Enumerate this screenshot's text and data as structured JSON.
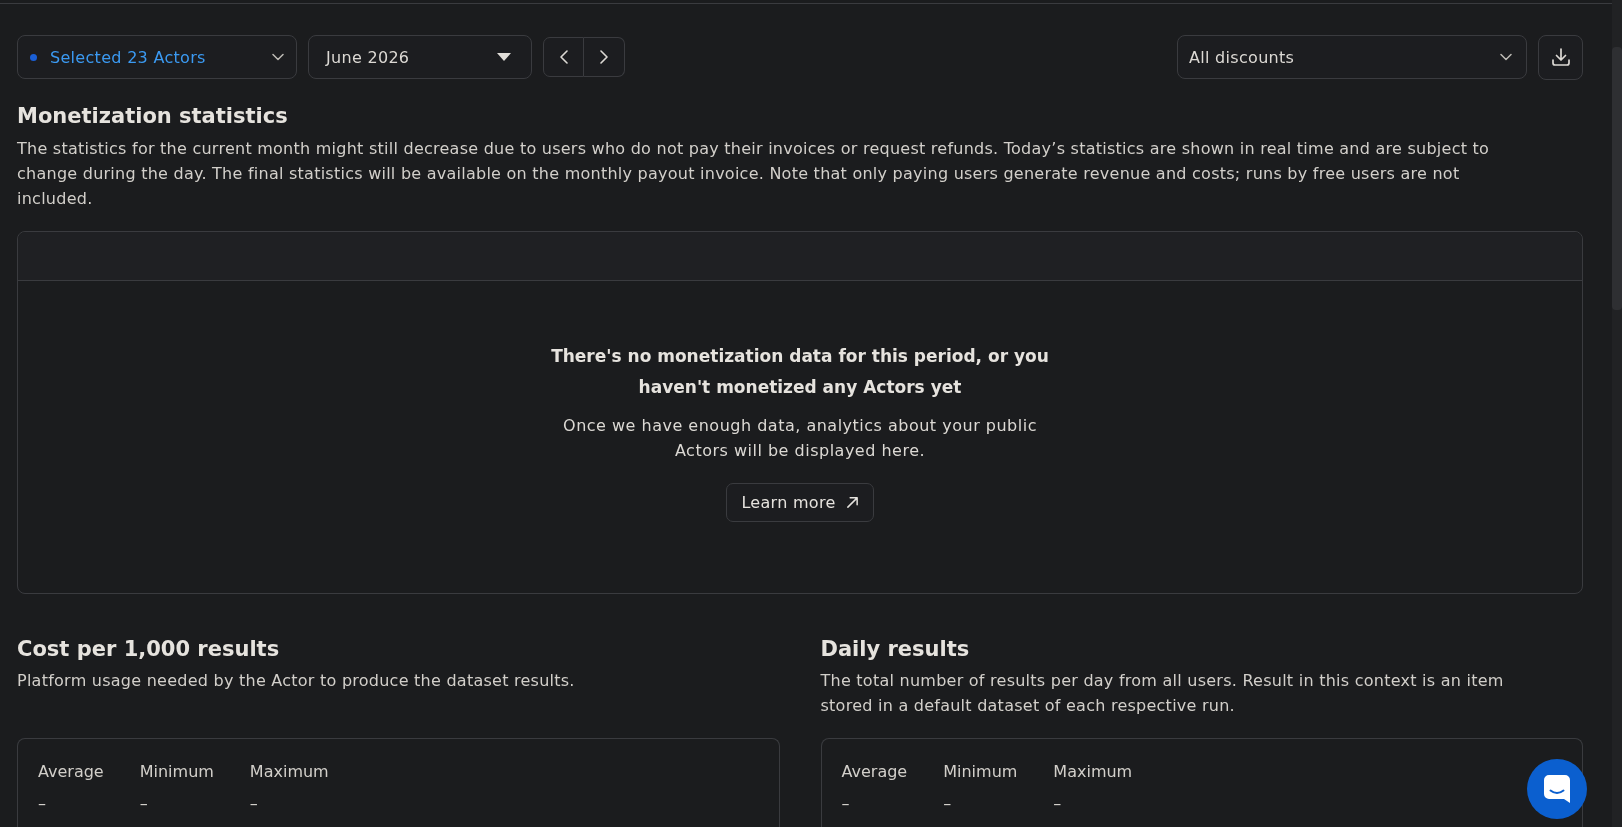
{
  "filters": {
    "actor_select": {
      "value": "Selected 23 Actors"
    },
    "month_select": {
      "value": "June 2026"
    },
    "discount_select": {
      "value": "All discounts"
    }
  },
  "monetization": {
    "title": "Monetization statistics",
    "description": "The statistics for the current month might still decrease due to users who do not pay their invoices or request refunds. Today’s statistics are shown in real time and are subject to change during the day. The final statistics will be available on the monthly payout invoice. Note that only paying users generate revenue and costs; runs by free users are not included.",
    "empty_state": {
      "title": "There's no monetization data for this period, or you haven't monetized any Actors yet",
      "message": "Once we have enough data, analytics about your public Actors will be displayed here.",
      "button": "Learn more"
    }
  },
  "sections": [
    {
      "title": "Cost per 1,000 results",
      "description": "Platform usage needed by the Actor to produce the dataset results.",
      "stats": [
        {
          "label": "Average",
          "value": "–"
        },
        {
          "label": "Minimum",
          "value": "–"
        },
        {
          "label": "Maximum",
          "value": "–"
        }
      ]
    },
    {
      "title": "Daily results",
      "description": "The total number of results per day from all users. Result in this context is an item stored in a default dataset of each respective run.",
      "stats": [
        {
          "label": "Average",
          "value": "–"
        },
        {
          "label": "Minimum",
          "value": "–"
        },
        {
          "label": "Maximum",
          "value": "–"
        }
      ]
    }
  ]
}
